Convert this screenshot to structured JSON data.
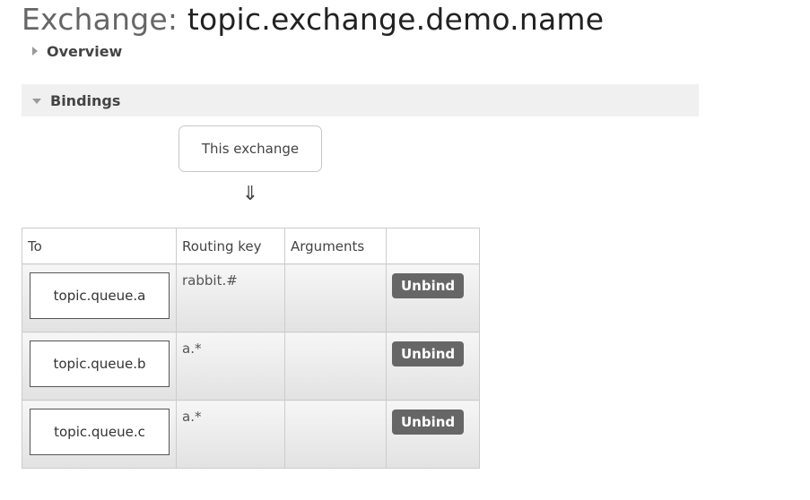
{
  "page": {
    "title_prefix": "Exchange:",
    "exchange_name": "topic.exchange.demo.name"
  },
  "sections": {
    "overview": {
      "label": "Overview",
      "expanded": false
    },
    "bindings": {
      "label": "Bindings",
      "expanded": true
    }
  },
  "bindings_diagram": {
    "source_label": "This exchange",
    "arrow": "⇓"
  },
  "bindings_table": {
    "headers": [
      "To",
      "Routing key",
      "Arguments",
      ""
    ],
    "rows": [
      {
        "queue": "topic.queue.a",
        "routing_key": "rabbit.#",
        "arguments": "",
        "action": "Unbind"
      },
      {
        "queue": "topic.queue.b",
        "routing_key": "a.*",
        "arguments": "",
        "action": "Unbind"
      },
      {
        "queue": "topic.queue.c",
        "routing_key": "a.*",
        "arguments": "",
        "action": "Unbind"
      }
    ]
  },
  "colors": {
    "section_header_bg": "#f0f0f0",
    "button_bg": "#666666",
    "border": "#cccccc"
  }
}
